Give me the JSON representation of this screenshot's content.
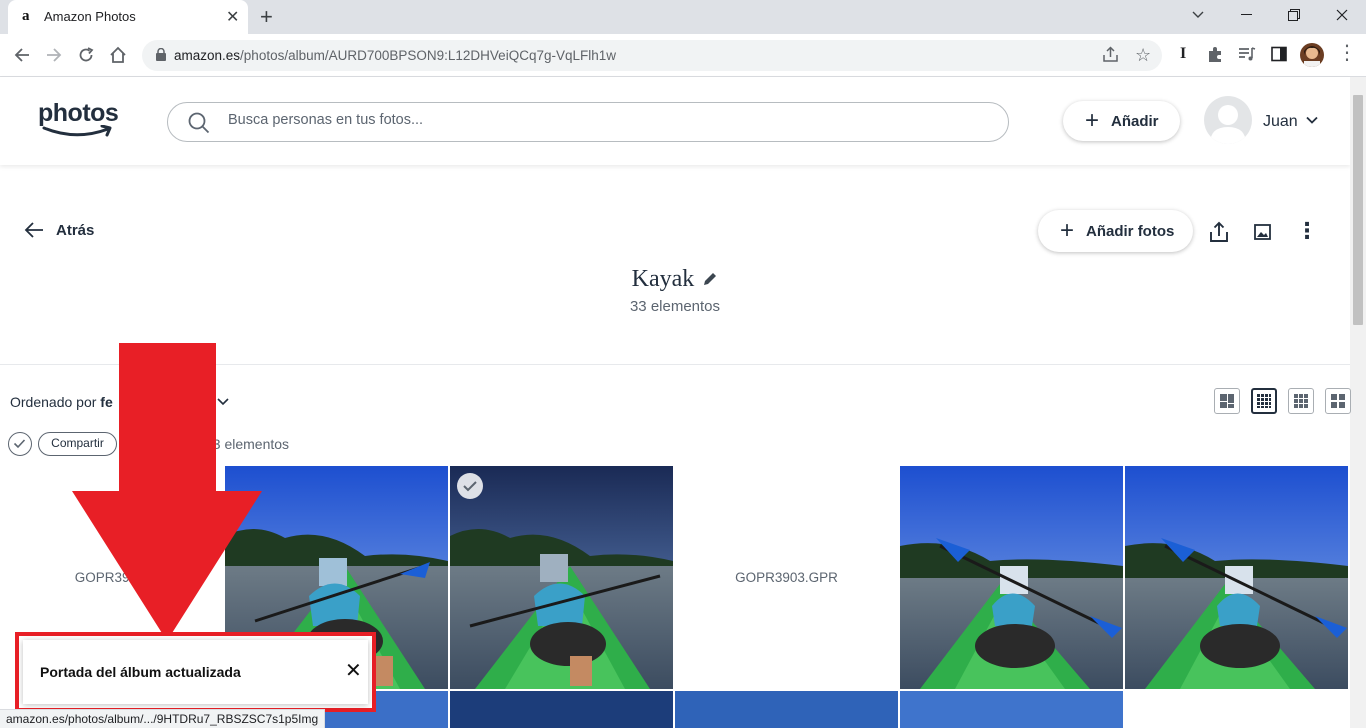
{
  "browser": {
    "tab_title": "Amazon Photos",
    "tab_favicon": "a",
    "url_host": "amazon.es",
    "url_path": "/photos/album/AURD700BPSON9:L12DHVeiQCq7g-VqLFlh1w",
    "status_url": "amazon.es/photos/album/.../9HTDRu7_RBSZSC7s1p5Img"
  },
  "header": {
    "logo_text": "photos",
    "search_placeholder": "Busca personas en tus fotos...",
    "add_label": "Añadir",
    "user_name": "Juan"
  },
  "album": {
    "back_label": "Atrás",
    "add_photos_label": "Añadir fotos",
    "title": "Kayak",
    "count_label": "33 elementos"
  },
  "toolbar": {
    "sort_prefix": "Ordenado por ",
    "sort_value": "fe",
    "share_label": "Compartir",
    "selected_count": "33 elementos"
  },
  "grid": {
    "file_1": "GOPR3902.",
    "file_2": "GOPR3903.GPR"
  },
  "toast": {
    "message": "Portada del álbum actualizada"
  },
  "colors": {
    "accent_red": "#e81f26",
    "text_dark": "#232f3e"
  }
}
